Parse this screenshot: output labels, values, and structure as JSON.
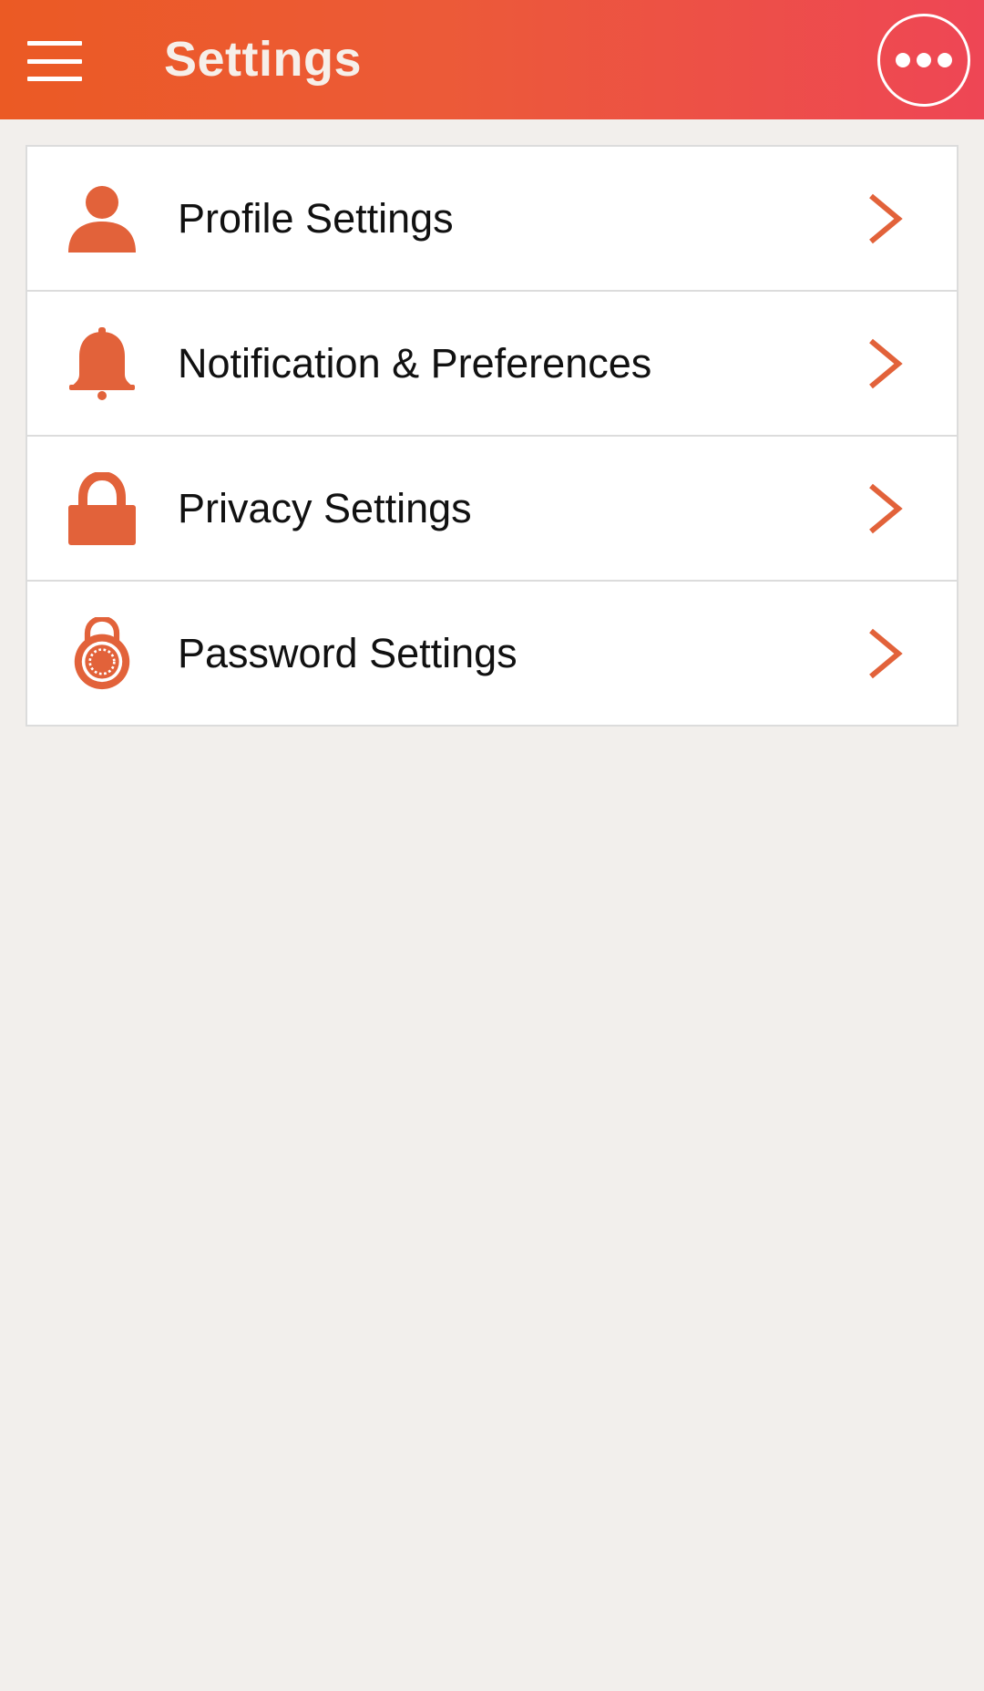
{
  "app_bar": {
    "title": "Settings",
    "menu_icon": "hamburger-menu-icon",
    "overflow_icon": "more-horizontal-icon"
  },
  "settings": {
    "items": [
      {
        "label": "Profile Settings",
        "icon": "person-icon"
      },
      {
        "label": "Notification & Preferences",
        "icon": "bell-icon"
      },
      {
        "label": "Privacy Settings",
        "icon": "lock-icon"
      },
      {
        "label": "Password Settings",
        "icon": "combination-lock-icon"
      }
    ]
  },
  "colors": {
    "accent": "#e2623a",
    "header_start": "#eb5a24",
    "header_end": "#ee4655",
    "background": "#f2efec"
  }
}
